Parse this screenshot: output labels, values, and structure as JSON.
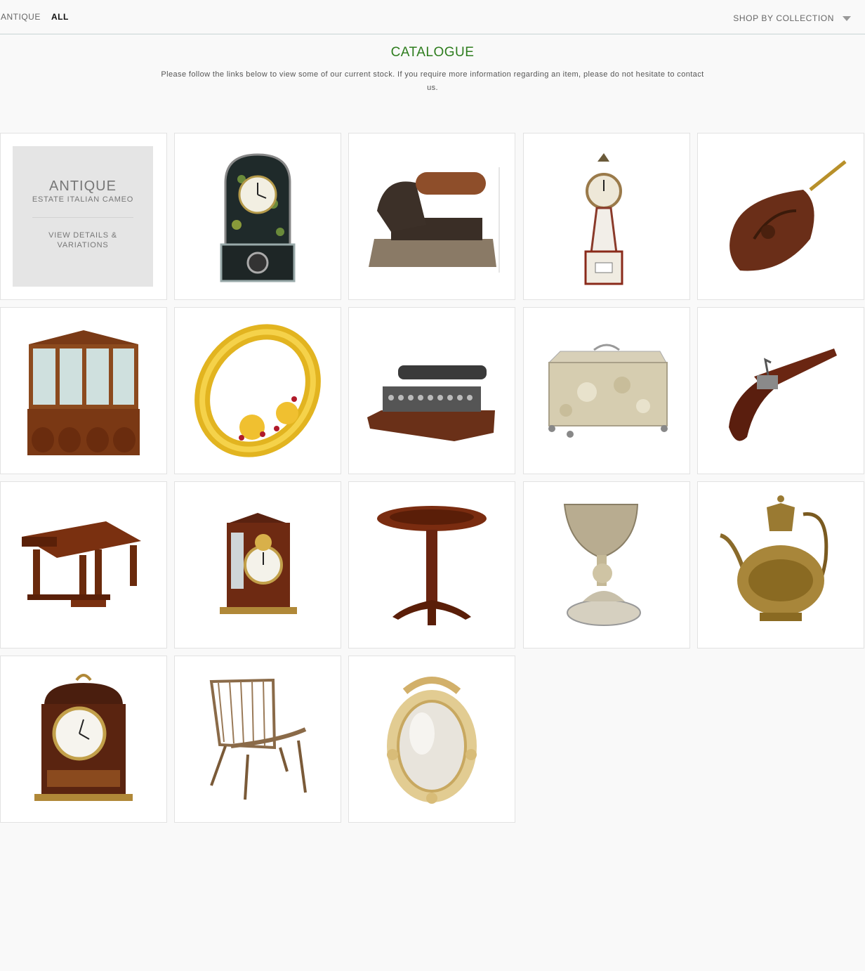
{
  "breadcrumb": {
    "first": "ANTIQUE",
    "second": "ALL"
  },
  "nav": {
    "shop_by": "SHOP BY COLLECTION",
    "caret_icon": "chevron-down-icon"
  },
  "header": {
    "title": "CATALOGUE",
    "intro": "Please follow the links below to view some of our current stock. If you require more information regarding an item, please do not hesitate to contact us."
  },
  "colors": {
    "title": "#2e7d1e",
    "feature_bg": "#e5e5e5",
    "page_bg": "#f9f9f9"
  },
  "feature": {
    "category": "ANTIQUE",
    "name": "ESTATE ITALIAN CAMEO",
    "link": "VIEW DETAILS & VARIATIONS"
  },
  "products": [
    {
      "icon": "gothic-mantel-clock-image"
    },
    {
      "icon": "antique-iron-image"
    },
    {
      "icon": "banjo-wall-clock-image"
    },
    {
      "icon": "carved-bellows-image"
    },
    {
      "icon": "glazed-bookcase-cabinet-image"
    },
    {
      "icon": "gold-ruby-bangle-image"
    },
    {
      "icon": "antique-typewriter-image"
    },
    {
      "icon": "silver-tea-caddy-image"
    },
    {
      "icon": "flintlock-pistol-image"
    },
    {
      "icon": "carved-refectory-table-image"
    },
    {
      "icon": "bracket-clock-image"
    },
    {
      "icon": "tilt-top-tripod-table-image"
    },
    {
      "icon": "silver-cherub-chalice-image"
    },
    {
      "icon": "brass-ewer-teapot-image"
    },
    {
      "icon": "bell-top-bracket-clock-image"
    },
    {
      "icon": "rattan-armchair-image"
    },
    {
      "icon": "gilt-oval-mirror-image"
    }
  ]
}
